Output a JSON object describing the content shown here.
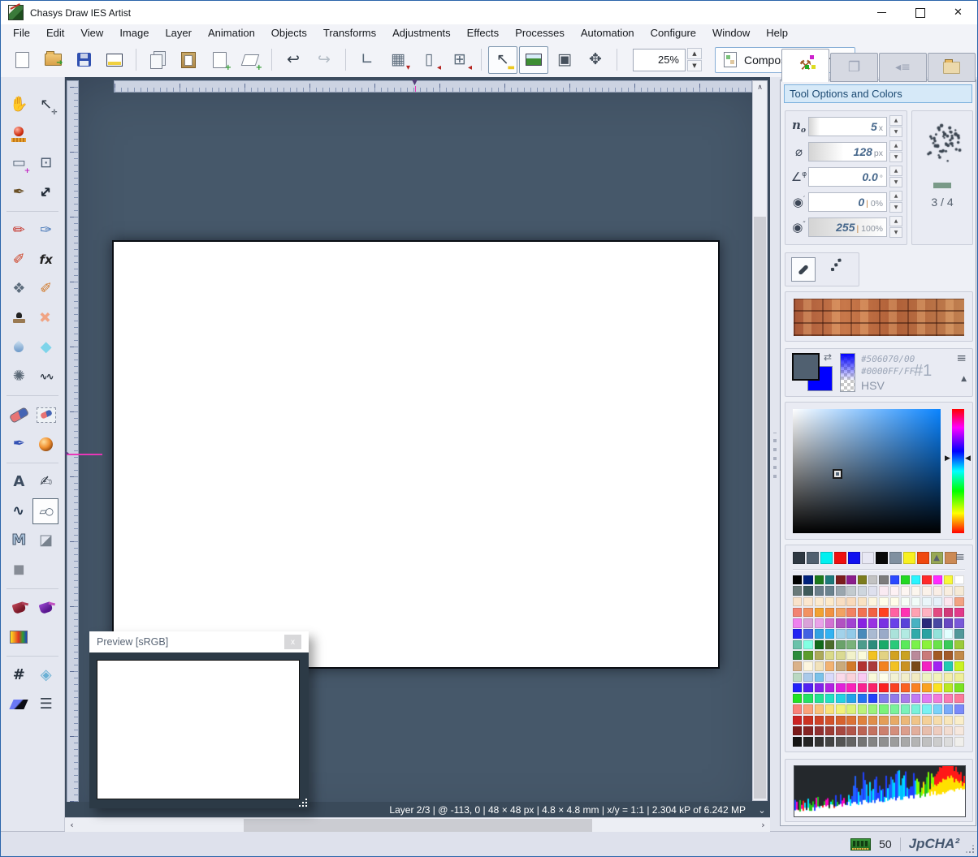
{
  "window": {
    "title": "Chasys Draw IES Artist"
  },
  "menu": {
    "items": [
      "File",
      "Edit",
      "View",
      "Image",
      "Layer",
      "Animation",
      "Objects",
      "Transforms",
      "Adjustments",
      "Effects",
      "Processes",
      "Automation",
      "Configure",
      "Window",
      "Help"
    ]
  },
  "toolbar": {
    "zoom_value": "25%",
    "composite_label": "Composite, Normal",
    "buttons": [
      {
        "n": "new-file",
        "shape": "sh-page"
      },
      {
        "n": "open-file",
        "shape": "sh-folder openarr"
      },
      {
        "n": "save-file",
        "shape": "sh-floppy"
      },
      {
        "n": "new-window",
        "shape": "sh-winpic"
      },
      "sep",
      {
        "n": "copy",
        "shape": "sh-copy"
      },
      {
        "n": "paste",
        "shape": "sh-paste"
      },
      {
        "n": "add-page",
        "shape": "sh-page",
        "o": "+",
        "oc": "#2a9a2a"
      },
      {
        "n": "add-layer",
        "shape": "sh-layer",
        "o": "+",
        "oc": "#2a9a2a"
      },
      "sep",
      {
        "n": "undo",
        "g": "↩",
        "c": "#36404c",
        "cls": "bold"
      },
      {
        "n": "redo",
        "g": "↪",
        "c": "#b4bcc6",
        "cls": "bold"
      },
      "sep",
      {
        "n": "canvas-size",
        "g": "∟",
        "c": "#5a6a7a",
        "cls": "bold"
      },
      {
        "n": "snap-grid",
        "g": "▦",
        "c": "#5a6a7a",
        "o": "▾",
        "oc": "#b42420"
      },
      {
        "n": "snap-object",
        "g": "▯",
        "c": "#5a6a7a",
        "o": "◂",
        "oc": "#b42420"
      },
      {
        "n": "snap-guides",
        "g": "⊞",
        "c": "#5a6a7a",
        "o": "◂",
        "oc": "#b42420"
      },
      "sep",
      {
        "n": "pointer-info",
        "g": "↖",
        "c": "#3c4652",
        "o": "▬",
        "oc": "#ecc820",
        "frame": true
      },
      {
        "n": "preview-toggle",
        "shape": "sh-pic",
        "frame": true
      },
      {
        "n": "frame-view",
        "g": "▣",
        "c": "#46505c"
      },
      {
        "n": "fit-screen",
        "g": "✥",
        "c": "#46505c"
      },
      "sep"
    ]
  },
  "tabs": [
    {
      "n": "tab-tool-options",
      "icon": "hammer",
      "active": true
    },
    {
      "n": "tab-layers",
      "icon": "layers",
      "active": false
    },
    {
      "n": "tab-navigator",
      "icon": "list",
      "active": false
    },
    {
      "n": "tab-files",
      "icon": "folder",
      "active": false
    }
  ],
  "tools": {
    "rows": [
      [
        {
          "n": "pan-tool",
          "g": "✋",
          "c": "#4a5560"
        },
        {
          "n": "move-tool",
          "g": "↖",
          "c": "#2e3844",
          "o": "✛",
          "oc": "#2e3844"
        }
      ],
      [
        {
          "n": "measure-tool",
          "shape": "sh-pin"
        },
        null
      ],
      [
        {
          "n": "selection-tool",
          "g": "▭",
          "c": "#5a6a7c",
          "o": "+",
          "oc": "#c020c0"
        },
        {
          "n": "crop-tool",
          "g": "⊡",
          "c": "#46566a"
        }
      ],
      [
        {
          "n": "knife-tool",
          "g": "✒",
          "c": "#6a5026"
        },
        {
          "n": "resize-tool",
          "g": "↔",
          "c": "#1e2834",
          "cls": "r45 bold"
        }
      ],
      "sep",
      [
        {
          "n": "pencil-tool",
          "g": "✏",
          "c": "#c43026"
        },
        {
          "n": "eyedropper-tool",
          "g": "✑",
          "c": "#4878b8"
        }
      ],
      [
        {
          "n": "paintbrush-tool",
          "g": "✐",
          "c": "#cc3c1e"
        },
        {
          "n": "fx-brush-tool",
          "g": "fx",
          "c": "#222222",
          "cls": "fx"
        }
      ],
      [
        {
          "n": "pattern-brush-tool",
          "g": "❖",
          "c": "#5c6c7c"
        },
        {
          "n": "airbrush-tool",
          "g": "✐",
          "c": "#d07828"
        }
      ],
      [
        {
          "n": "clone-stamp-tool",
          "shape": "sh-stamp"
        },
        {
          "n": "heal-tool",
          "g": "✚",
          "c": "#f0a484",
          "cls": "r45 bold"
        }
      ],
      [
        {
          "n": "water-drop-tool",
          "shape": "sh-drop"
        },
        {
          "n": "jewel-tool",
          "g": "◆",
          "c": "#7ed4ea"
        }
      ],
      [
        {
          "n": "splatter-tool",
          "g": "✺",
          "c": "#5a6876"
        },
        {
          "n": "zigzag-tool",
          "g": "∿∿",
          "c": "#26303c",
          "cls": "sm bold"
        }
      ],
      "sep",
      [
        {
          "n": "eraser-tool",
          "shape": "sh-eraser"
        },
        {
          "n": "background-eraser-tool",
          "shape": "sh-eraser2"
        }
      ],
      [
        {
          "n": "marker-tool",
          "g": "✒",
          "c": "#3452b4"
        },
        {
          "n": "sphere-tool",
          "shape": "sh-sphere"
        }
      ],
      "sep",
      [
        {
          "n": "text-tool",
          "g": "A",
          "c": "#3c4c60",
          "cls": "bold"
        },
        {
          "n": "calligraphy-tool",
          "g": "✍",
          "c": "#333c48"
        }
      ],
      [
        {
          "n": "curve-tool",
          "g": "∿",
          "c": "#26384e",
          "cls": "bold"
        },
        {
          "n": "shapes-tool",
          "g": "▱○",
          "c": "#3a4a5e",
          "cls": "sm",
          "sel": true
        }
      ],
      [
        {
          "n": "polygon-tool",
          "g": "M",
          "c": "#a8c0d8",
          "cls": "poly"
        },
        {
          "n": "solid-shapes-tool",
          "g": "◪",
          "c": "#78828e"
        }
      ],
      [
        {
          "n": "cube-tool",
          "g": "◼",
          "c": "#868c96"
        },
        null
      ],
      "sep",
      [
        {
          "n": "fill-tool",
          "shape": "sh-bucket"
        },
        {
          "n": "pattern-fill-tool",
          "shape": "sh-bucket purple"
        }
      ],
      [
        {
          "n": "gradient-tool",
          "shape": "sh-grad"
        },
        null
      ],
      "sep",
      [
        {
          "n": "mesh-tool",
          "g": "#",
          "c": "#26303c",
          "cls": "bold"
        },
        {
          "n": "warp-tool",
          "g": "◈",
          "c": "#6ab0d4"
        }
      ],
      [
        {
          "n": "shear-tool",
          "shape": "sh-shear"
        },
        {
          "n": "levels-tool",
          "g": "☰",
          "c": "#38424e"
        }
      ]
    ]
  },
  "right_panel": {
    "header": "Tool Options and Colors",
    "options": [
      {
        "name": "count",
        "base": "n",
        "sub": "o",
        "italic": true,
        "value": "5",
        "unit": "x",
        "fill": 14
      },
      {
        "name": "diameter",
        "base": "⌀",
        "value": "128",
        "unit": "px",
        "fill": 45
      },
      {
        "name": "angle",
        "base": "∠",
        "sup": "φ",
        "value": "0.0",
        "unit": "°",
        "fill": 0
      },
      {
        "name": "alpha-low",
        "base": "◉",
        "sup": "′",
        "value": "0",
        "unit": "| 0%",
        "fill": 0
      },
      {
        "name": "alpha-high",
        "base": "◉",
        "sup": "″",
        "value": "255",
        "unit": "| 100%",
        "fill": 100
      }
    ],
    "brush_page": "3 / 4",
    "color": {
      "fg": "#506070",
      "bg": "#0000ff",
      "fg_hex_label": "#506070/00",
      "bg_hex_label": "#0000FF/FF",
      "mode": "HSV",
      "slot": "#1"
    },
    "recent_colors": [
      "#2e3842",
      "#506070",
      "#00f0f0",
      "#f01010",
      "#1010f0",
      "#e8e8f4",
      "#080808",
      "#8090a0",
      "#f8f020",
      "#f04810",
      "#98a855",
      "#cc8a55"
    ],
    "palette": [
      [
        "#000000",
        "#00217c",
        "#1d7a1d",
        "#1d7a7a",
        "#7c1d1d",
        "#8b1d8b",
        "#7c7c1d",
        "#c2c2c2",
        "#7c7c7c",
        "#2a48ff",
        "#22d822",
        "#2af5ff",
        "#ff2a2a",
        "#ff2aff",
        "#f8f838",
        "#ffffff"
      ],
      [
        "#6a7a7a",
        "#3e5a5a",
        "#6a7e8a",
        "#6a828e",
        "#9aa6ae",
        "#c2cace",
        "#ced6de",
        "#dee0ee",
        "#f9eaf2",
        "#fdf1f4",
        "#fdf6f2",
        "#fcf6ee",
        "#fbf2ea",
        "#faeee6",
        "#f9eedf",
        "#f5ead6"
      ],
      [
        "#f9e2ca",
        "#fbe6ce",
        "#fceacf",
        "#fdeaca",
        "#f9dec2",
        "#f9dabb",
        "#f9e2c2",
        "#fdf6de",
        "#fefee9",
        "#fffee9",
        "#f6fef6",
        "#f1fcf8",
        "#eaf6fa",
        "#e6f2fa",
        "#fde6ee",
        "#f2a282"
      ],
      [
        "#f28272",
        "#f29262",
        "#f2a232",
        "#f29242",
        "#f2a262",
        "#f28262",
        "#f27252",
        "#f26242",
        "#ff4222",
        "#ff62a2",
        "#ff32b2",
        "#ffa2b2",
        "#ffb2c2",
        "#e24a82",
        "#d23a7a",
        "#e23a8a"
      ],
      [
        "#ee82ee",
        "#d9a2d9",
        "#e9a2e9",
        "#d272d2",
        "#b252c2",
        "#a242d2",
        "#8922e2",
        "#9932e2",
        "#7932e2",
        "#6942e9",
        "#5942d9",
        "#49b2c2",
        "#2a2a7a",
        "#4949a2",
        "#6949c2",
        "#7959d9"
      ],
      [
        "#2222f2",
        "#4262e2",
        "#32a2e2",
        "#32b2f2",
        "#a2d2ea",
        "#92cae8",
        "#4a8aba",
        "#aabad2",
        "#9aaac8",
        "#aae2da",
        "#b2eae2",
        "#32aaaa",
        "#2aa2a2",
        "#92e2da",
        "#e2ffff",
        "#52989a"
      ],
      [
        "#6ac2aa",
        "#82ffe2",
        "#126a1a",
        "#4c6c2c",
        "#6aa26a",
        "#7ab27a",
        "#4c9c8c",
        "#2c8c7c",
        "#1aaa6a",
        "#2aca7a",
        "#5aea5a",
        "#7af24a",
        "#8af23a",
        "#6ae24a",
        "#3aca5a",
        "#9aca3a"
      ],
      [
        "#2c8c3c",
        "#5c9c2c",
        "#acaa5a",
        "#dada8a",
        "#dada92",
        "#f2f2ca",
        "#fbfbda",
        "#f2c222",
        "#e2d282",
        "#d2a222",
        "#caa222",
        "#ba8a9a",
        "#ca7a7a",
        "#a25a22",
        "#a25a2a",
        "#c28a4a"
      ],
      [
        "#dab28a",
        "#fdf6de",
        "#f2e2ba",
        "#f2b272",
        "#caaa7a",
        "#d27a2a",
        "#b23232",
        "#aa3a3a",
        "#f28222",
        "#f2c222",
        "#ca9222",
        "#7a4a1a",
        "#f222c2",
        "#a222f2",
        "#22cab2",
        "#caf222"
      ],
      [
        "#bad8c2",
        "#aacaea",
        "#7ac2ea",
        "#dadafa",
        "#fadaea",
        "#fad2da",
        "#facaf2",
        "#fafada",
        "#fefeea",
        "#f2f2d2",
        "#f2eeca",
        "#f2eac2",
        "#eef2c2",
        "#f2f2ba",
        "#f2eea a",
        "#eeee9a"
      ],
      [
        "#2222fa",
        "#5222f2",
        "#8222ea",
        "#b222e2",
        "#e222da",
        "#fa22ba",
        "#fa2292",
        "#fa226a",
        "#fa2222",
        "#fa4222",
        "#fa6222",
        "#fa8222",
        "#faa222",
        "#fae222",
        "#bae822",
        "#7ae222"
      ],
      [
        "#22e222",
        "#22e262",
        "#22e292",
        "#22e2c2",
        "#22d2e2",
        "#22a2ea",
        "#2272f2",
        "#2242fa",
        "#827aea",
        "#927aea",
        "#aa7aea",
        "#c27af2",
        "#e27af2",
        "#f27ada",
        "#fa7ab2",
        "#fa7a9a"
      ],
      [
        "#fa827a",
        "#faa27a",
        "#fac27a",
        "#fae27a",
        "#f2f27a",
        "#daf27a",
        "#baf27a",
        "#9af27a",
        "#7af27a",
        "#7af29a",
        "#7af2ba",
        "#7af2da",
        "#7af2f2",
        "#7ad2fa",
        "#7aaafa",
        "#7a8afa"
      ],
      [
        "#cc2222",
        "#cc3222",
        "#d04226",
        "#d4522a",
        "#d8622e",
        "#dc7236",
        "#e0823e",
        "#e08e4a",
        "#e49e58",
        "#e8aa66",
        "#ecb878",
        "#f0c488",
        "#f4d098",
        "#f6dcaa",
        "#f8e6ba",
        "#faeeca"
      ],
      [
        "#7a1a1a",
        "#862424",
        "#923030",
        "#9e3c34",
        "#a84840",
        "#b2564a",
        "#bc6454",
        "#c47260",
        "#cc806e",
        "#d48e7c",
        "#dc9e8c",
        "#e2ae9c",
        "#e8beac",
        "#eeccbe",
        "#f2dcd0",
        "#f6e8de"
      ],
      [
        "#141414",
        "#242424",
        "#343434",
        "#444444",
        "#545454",
        "#646464",
        "#747474",
        "#848484",
        "#909090",
        "#9c9c9c",
        "#a8a8a8",
        "#b4b4b4",
        "#c0c0c0",
        "#cccccc",
        "#dcdcdc",
        "#f0efec"
      ]
    ]
  },
  "canvas": {
    "status": "Layer 2/3 | @ -113, 0 | 48 × 48 px | 4.8 × 4.8 mm | x/y = 1:1 | 2.304 kP of 6.242 MP"
  },
  "preview": {
    "title": "Preview [sRGB]",
    "close": "x"
  },
  "statusbar": {
    "memory": "50",
    "brand": "JpCHA²"
  }
}
